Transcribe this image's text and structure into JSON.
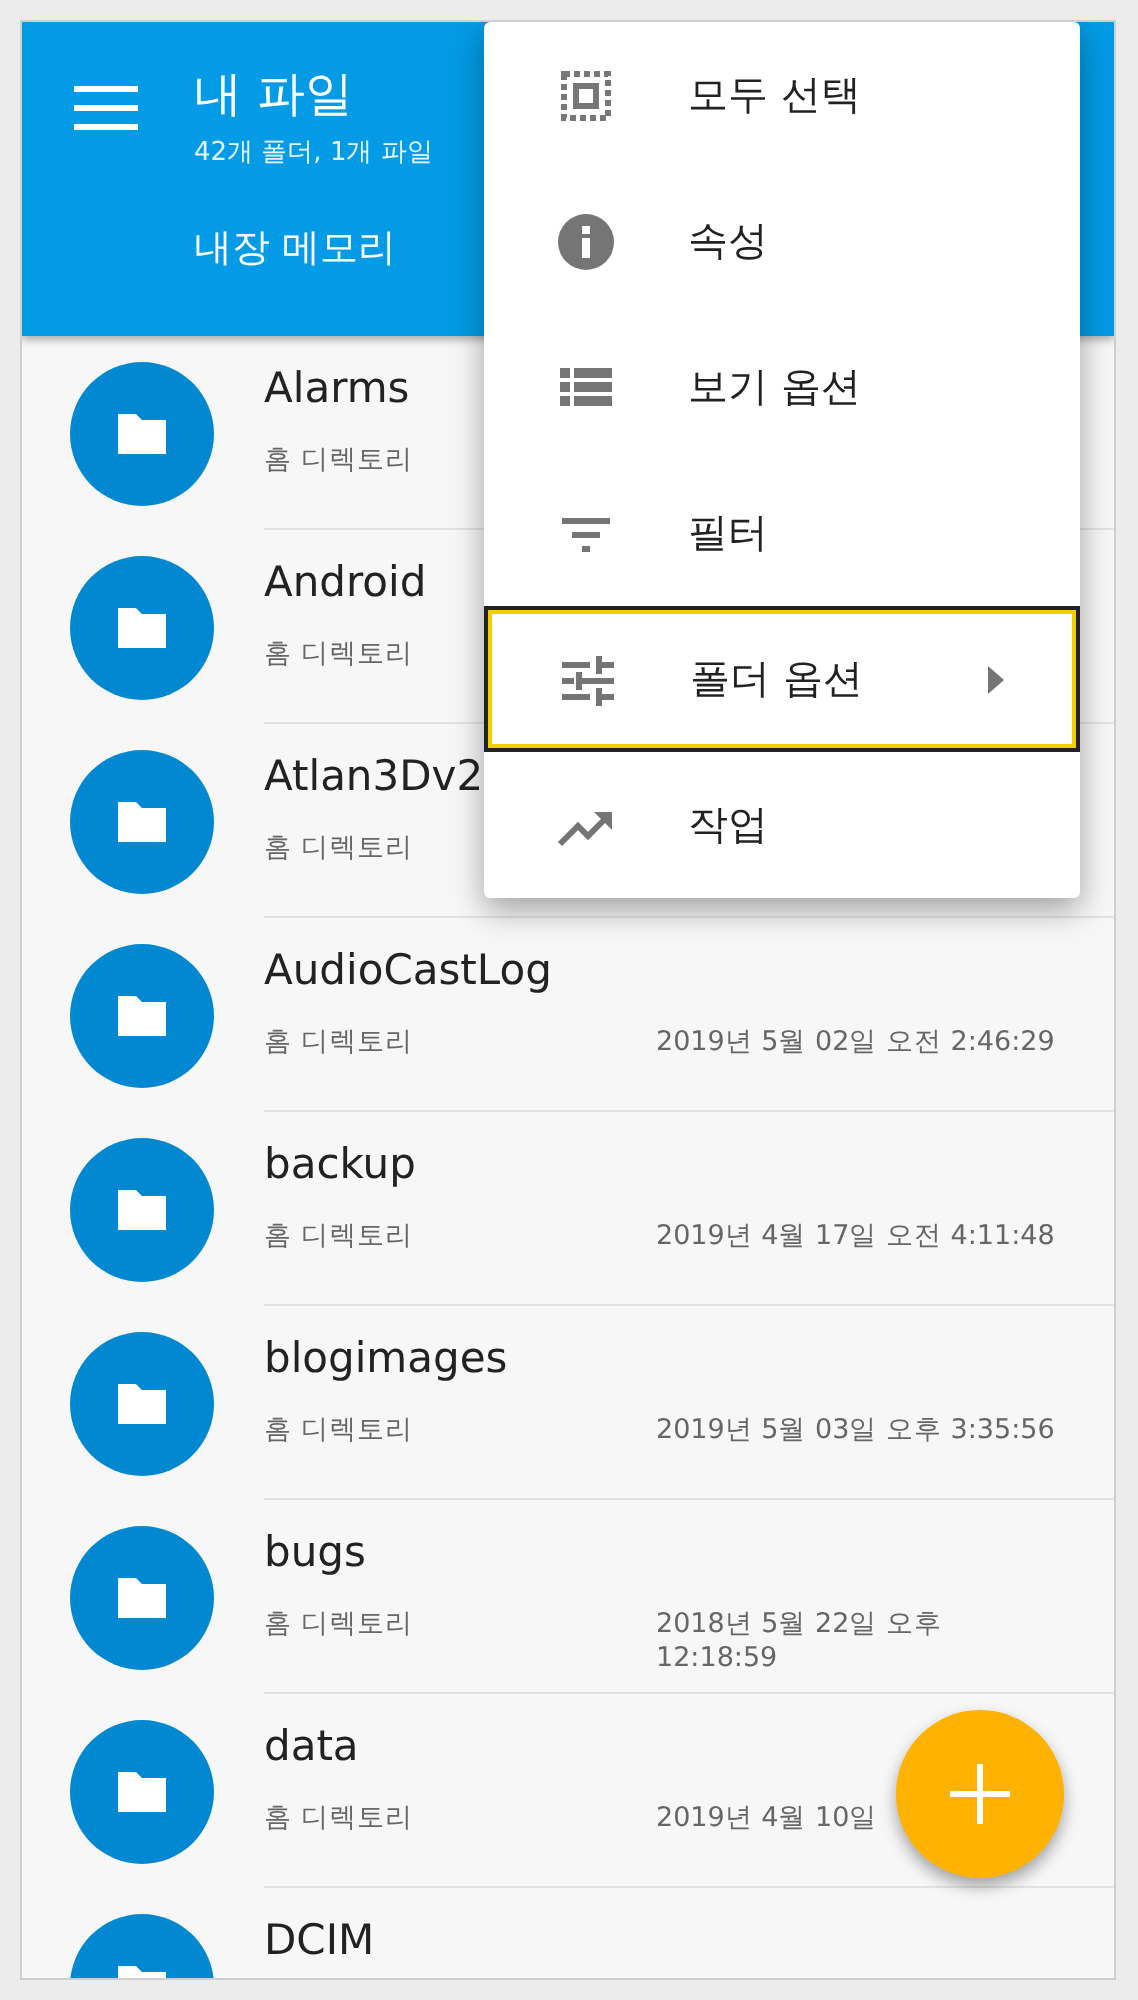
{
  "app_bar": {
    "title": "내 파일",
    "subtitle": "42개 폴더, 1개 파일",
    "tab": "내장 메모리"
  },
  "files": [
    {
      "name": "Alarms",
      "location": "홈 디렉토리"
    },
    {
      "name": "Android",
      "location": "홈 디렉토리"
    },
    {
      "name": "Atlan3Dv2",
      "location": "홈 디렉토리"
    },
    {
      "name": "AudioCastLog",
      "location": "홈 디렉토리",
      "modified": "2019년 5월 02일 오전 2:46:29"
    },
    {
      "name": "backup",
      "location": "홈 디렉토리",
      "modified": "2019년 4월 17일 오전 4:11:48"
    },
    {
      "name": "blogimages",
      "location": "홈 디렉토리",
      "modified": "2019년 5월 03일 오후 3:35:56"
    },
    {
      "name": "bugs",
      "location": "홈 디렉토리",
      "modified": "2018년 5월 22일 오후 12:18:59"
    },
    {
      "name": "data",
      "location": "홈 디렉토리",
      "modified": "2019년 4월 10일"
    },
    {
      "name": "DCIM"
    }
  ],
  "menu": [
    {
      "label": "모두 선택",
      "selected": false,
      "has_submenu": false
    },
    {
      "label": "속성",
      "selected": false,
      "has_submenu": false
    },
    {
      "label": "보기 옵션",
      "selected": false,
      "has_submenu": false
    },
    {
      "label": "필터",
      "selected": false,
      "has_submenu": false
    },
    {
      "label": "폴더 옵션",
      "selected": true,
      "has_submenu": true
    },
    {
      "label": "작업",
      "selected": false,
      "has_submenu": false
    }
  ]
}
